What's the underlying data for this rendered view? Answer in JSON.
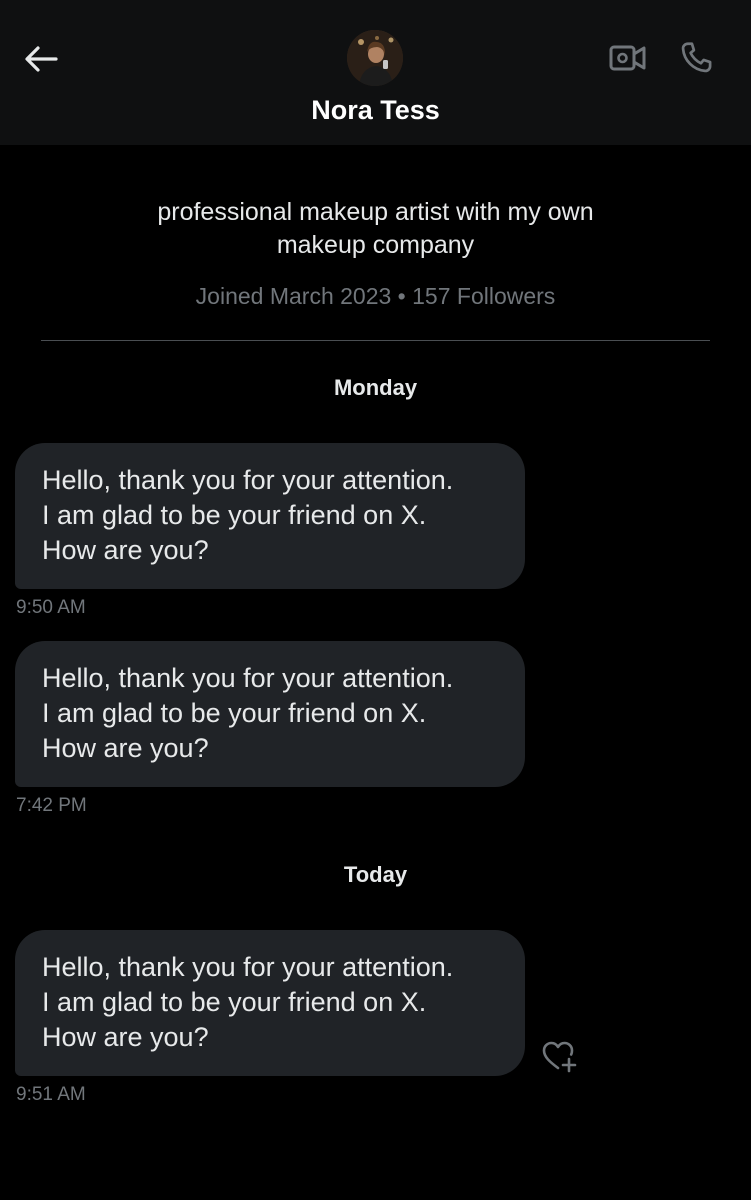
{
  "header": {
    "contact_name": "Nora Tess",
    "icons": {
      "back": "arrow-left-icon",
      "video": "video-call-icon",
      "phone": "phone-icon"
    }
  },
  "profile": {
    "bio_line1": "professional makeup artist with my own",
    "bio_line2": "makeup company",
    "meta": "Joined March 2023 • 157 Followers"
  },
  "conversation": {
    "day_groups": [
      {
        "label": "Monday",
        "messages": [
          {
            "lines": [
              "Hello, thank you for your attention.",
              "I am glad to be your friend on X.",
              "How are you?"
            ],
            "time": "9:50 AM"
          },
          {
            "lines": [
              "Hello, thank you for your attention.",
              "I am glad to be your friend on X.",
              "How are you?"
            ],
            "time": "7:42 PM"
          }
        ]
      },
      {
        "label": "Today",
        "messages": [
          {
            "lines": [
              "Hello, thank you for your attention.",
              "I am glad to be your friend on X.",
              "How are you?"
            ],
            "time": "9:51 AM",
            "reaction_icon": "heart-plus-icon"
          }
        ]
      }
    ]
  },
  "colors": {
    "background": "#000000",
    "header_bg": "#0f1011",
    "bubble_bg": "#202327",
    "primary_text": "#e7e9ea",
    "secondary_text": "#71767b"
  }
}
